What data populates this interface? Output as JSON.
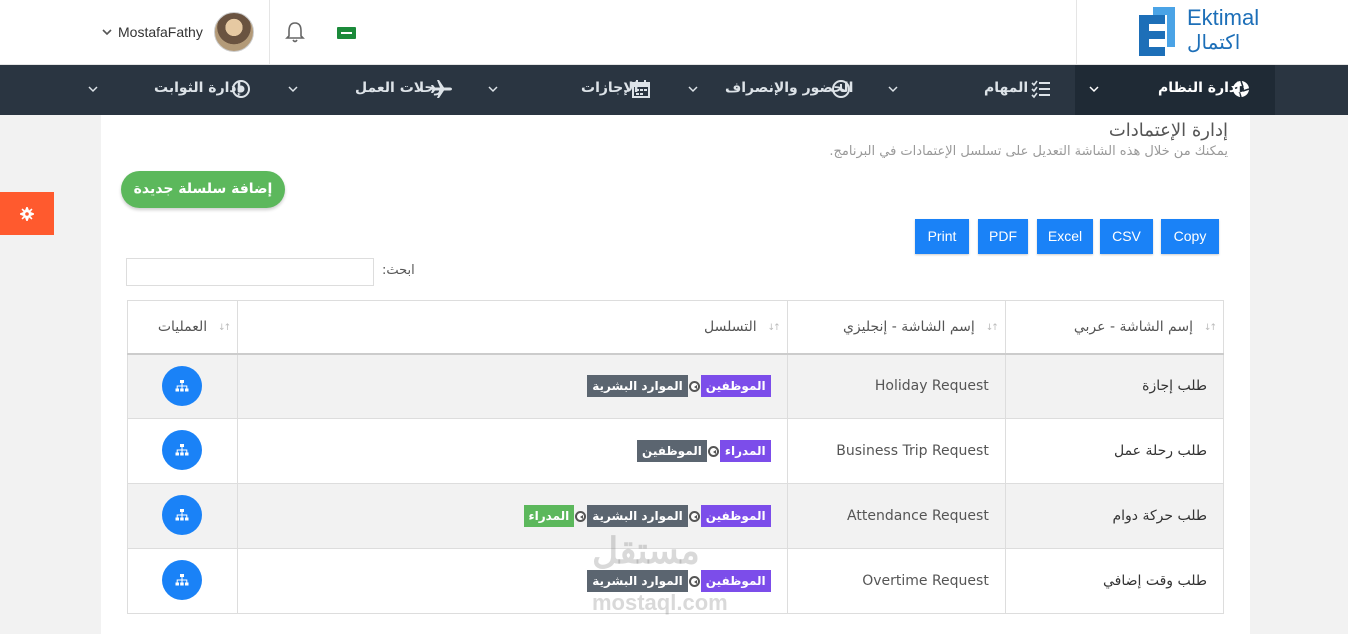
{
  "header": {
    "logo_en": "Ektimal",
    "logo_ar": "اكتمال",
    "user_name": "MostafaFathy"
  },
  "nav": [
    {
      "label": "إدارة النظام",
      "icon": "aperture-icon",
      "active": true
    },
    {
      "label": "المهام",
      "icon": "tasks-icon",
      "active": false
    },
    {
      "label": "الحضور والإنصراف",
      "icon": "clock-icon",
      "active": false
    },
    {
      "label": "الإجازات",
      "icon": "calendar-icon",
      "active": false
    },
    {
      "label": "رحلات العمل",
      "icon": "plane-icon",
      "active": false
    },
    {
      "label": "إدارة الثوابت",
      "icon": "target-icon",
      "active": false
    }
  ],
  "page": {
    "title": "إدارة الإعتمادات",
    "subtitle": "يمكنك من خلال هذه الشاشة التعديل على تسلسل الإعتمادات في البرنامج.",
    "add_button": "إضافة سلسلة جديدة"
  },
  "export_buttons": [
    "Copy",
    "CSV",
    "Excel",
    "PDF",
    "Print"
  ],
  "search": {
    "label": "ابحث:",
    "value": ""
  },
  "table": {
    "headers": [
      "إسم الشاشة - عربي",
      "إسم الشاشة - إنجليزي",
      "التسلسل",
      "العمليات"
    ],
    "rows": [
      {
        "name_ar": "طلب إجازة",
        "name_en": "Holiday Request",
        "chain": [
          {
            "label": "الموظفين",
            "color": "#7c4dea"
          },
          {
            "label": "الموارد البشرية",
            "color": "#5b6570"
          }
        ]
      },
      {
        "name_ar": "طلب رحلة عمل",
        "name_en": "Business Trip Request",
        "chain": [
          {
            "label": "المدراء",
            "color": "#7c4dea"
          },
          {
            "label": "الموظفين",
            "color": "#5b6570"
          }
        ]
      },
      {
        "name_ar": "طلب حركة دوام",
        "name_en": "Attendance Request",
        "chain": [
          {
            "label": "الموظفين",
            "color": "#7c4dea"
          },
          {
            "label": "الموارد البشرية",
            "color": "#5b6570"
          },
          {
            "label": "المدراء",
            "color": "#5cb85c"
          }
        ]
      },
      {
        "name_ar": "طلب وقت إضافي",
        "name_en": "Overtime Request",
        "chain": [
          {
            "label": "الموظفين",
            "color": "#7c4dea"
          },
          {
            "label": "الموارد البشرية",
            "color": "#5b6570"
          }
        ]
      }
    ]
  },
  "watermark": {
    "ar": "مستقل",
    "en": "mostaql.com"
  },
  "colors": {
    "nav_bg": "#2a3541",
    "primary": "#1a82f7",
    "success": "#5cb85c",
    "accent": "#ff5a2e"
  }
}
